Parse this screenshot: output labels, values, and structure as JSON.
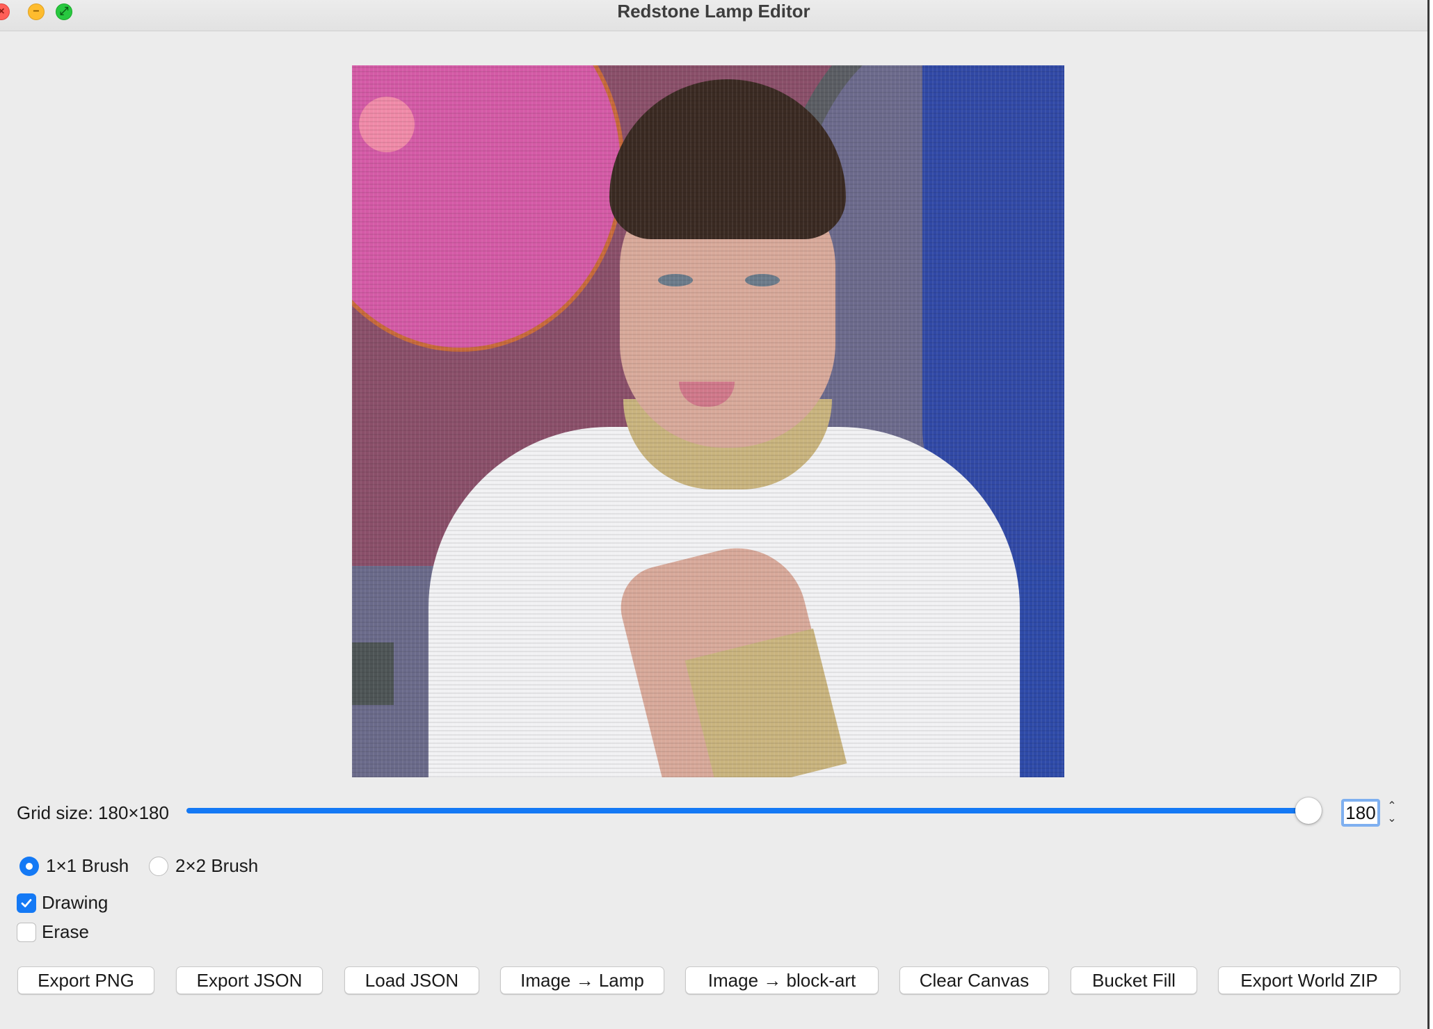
{
  "window": {
    "title": "Redstone Lamp Editor",
    "traffic_lights": [
      "close-icon",
      "minimize-icon",
      "zoom-icon"
    ]
  },
  "grid": {
    "label": "Grid size: 180×180",
    "value": "180",
    "slider_fraction": 1.0,
    "spin_up": "⌃",
    "spin_down": "⌄"
  },
  "brush": {
    "options": [
      "1×1 Brush",
      "2×2 Brush"
    ],
    "selected": "1×1 Brush"
  },
  "modes": {
    "drawing": {
      "label": "Drawing",
      "checked": true
    },
    "erase": {
      "label": "Erase",
      "checked": false
    }
  },
  "toolbar": {
    "buttons": [
      "Export PNG",
      "Export JSON",
      "Load JSON",
      "Image → Lamp",
      "Image → block-art",
      "Clear Canvas",
      "Bucket Fill",
      "Export World ZIP"
    ]
  },
  "colors": {
    "accent": "#1479f5",
    "window_bg": "#ececec"
  }
}
